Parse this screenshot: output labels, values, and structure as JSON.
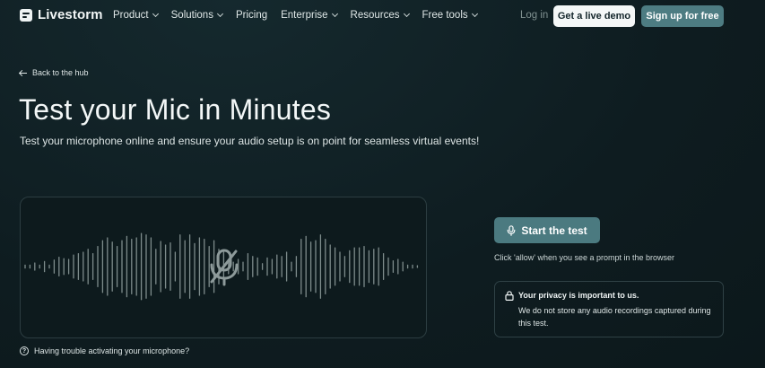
{
  "header": {
    "brand": "Livestorm",
    "nav": [
      {
        "label": "Product",
        "dropdown": true
      },
      {
        "label": "Solutions",
        "dropdown": true
      },
      {
        "label": "Pricing",
        "dropdown": false
      },
      {
        "label": "Enterprise",
        "dropdown": true
      },
      {
        "label": "Resources",
        "dropdown": true
      },
      {
        "label": "Free tools",
        "dropdown": true
      }
    ],
    "login_label": "Log in",
    "demo_label": "Get a live demo",
    "signup_label": "Sign up for free"
  },
  "back_link": "Back to the hub",
  "hero": {
    "title": "Test your Mic in Minutes",
    "subtitle": "Test your microphone online and ensure your audio setup is on point for seamless virtual events!"
  },
  "waveform": {
    "icon": "mic-off-icon",
    "bar_levels": [
      0.02,
      0.02,
      0.05,
      0.02,
      0.07,
      0.02,
      0.09,
      0.13,
      0.11,
      0.1,
      0.16,
      0.18,
      0.2,
      0.24,
      0.18,
      0.28,
      0.36,
      0.4,
      0.34,
      0.28,
      0.36,
      0.42,
      0.38,
      0.4,
      0.46,
      0.44,
      0.4,
      0.24,
      0.35,
      0.3,
      0.33,
      0.2,
      0.44,
      0.36,
      0.44,
      0.32,
      0.4,
      0.38,
      0.28,
      0.36,
      0.24,
      0.2,
      0.1,
      0.06,
      0.1,
      0.06,
      0.18,
      0.14,
      0.12,
      0.04,
      0.12,
      0.1,
      0.16,
      0.14,
      0.2,
      0.06,
      0.14,
      0.38,
      0.42,
      0.34,
      0.36,
      0.44,
      0.38,
      0.3,
      0.26,
      0.2,
      0.14,
      0.22,
      0.26,
      0.26,
      0.28,
      0.22,
      0.24,
      0.26,
      0.18,
      0.12,
      0.08,
      0.1,
      0.06,
      0.02,
      0.02,
      0.01
    ]
  },
  "help_link": "Having trouble activating your microphone?",
  "test": {
    "start_label": "Start the test",
    "hint": "Click 'allow' when you see a prompt in the browser"
  },
  "privacy": {
    "title": "Your privacy is important to us.",
    "body": "We do not store any audio recordings captured during this test."
  },
  "colors": {
    "background": "#0f1e22",
    "accent": "#4d7c82",
    "demo_button": "#f4f7f7"
  }
}
